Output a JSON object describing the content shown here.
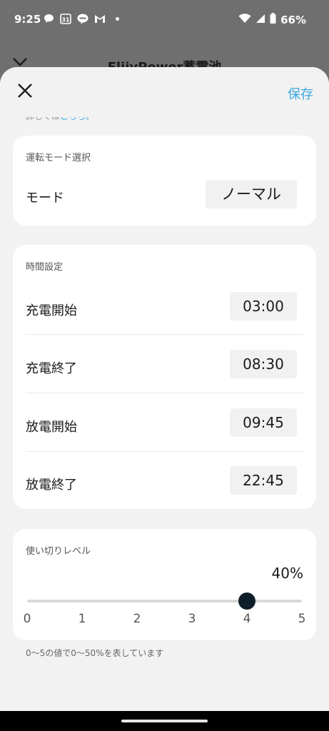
{
  "status_bar": {
    "time": "9:25",
    "battery": "66%",
    "icons": [
      "chat-bubble-icon",
      "calendar-31-icon",
      "line-icon",
      "gmail-icon",
      "notification-dot-icon",
      "wifi-icon",
      "signal-icon",
      "battery-icon"
    ]
  },
  "underlying_page": {
    "title": "FlijyPower蓄電池"
  },
  "sheet": {
    "save_label": "保存",
    "peek_text": "詳しくは",
    "peek_link": "こちら。"
  },
  "mode_card": {
    "label": "運転モード選択",
    "row_label": "モード",
    "value": "ノーマル"
  },
  "time_card": {
    "label": "時間設定",
    "rows": [
      {
        "label": "充電開始",
        "value": "03:00"
      },
      {
        "label": "充電終了",
        "value": "08:30"
      },
      {
        "label": "放電開始",
        "value": "09:45"
      },
      {
        "label": "放電終了",
        "value": "22:45"
      }
    ]
  },
  "level_card": {
    "label": "使い切りレベル",
    "value_text": "40%",
    "slider_value": 4,
    "slider_min": 0,
    "slider_max": 5,
    "ticks": [
      "0",
      "1",
      "2",
      "3",
      "4",
      "5"
    ]
  },
  "footnote": "0〜5の値で0〜50%を表しています",
  "colors": {
    "accent": "#3aa6e0",
    "thumb": "#0f1f2a",
    "sheet_bg": "#f2f2f2",
    "card_bg": "#ffffff",
    "pill_bg": "#f1f1f1"
  }
}
